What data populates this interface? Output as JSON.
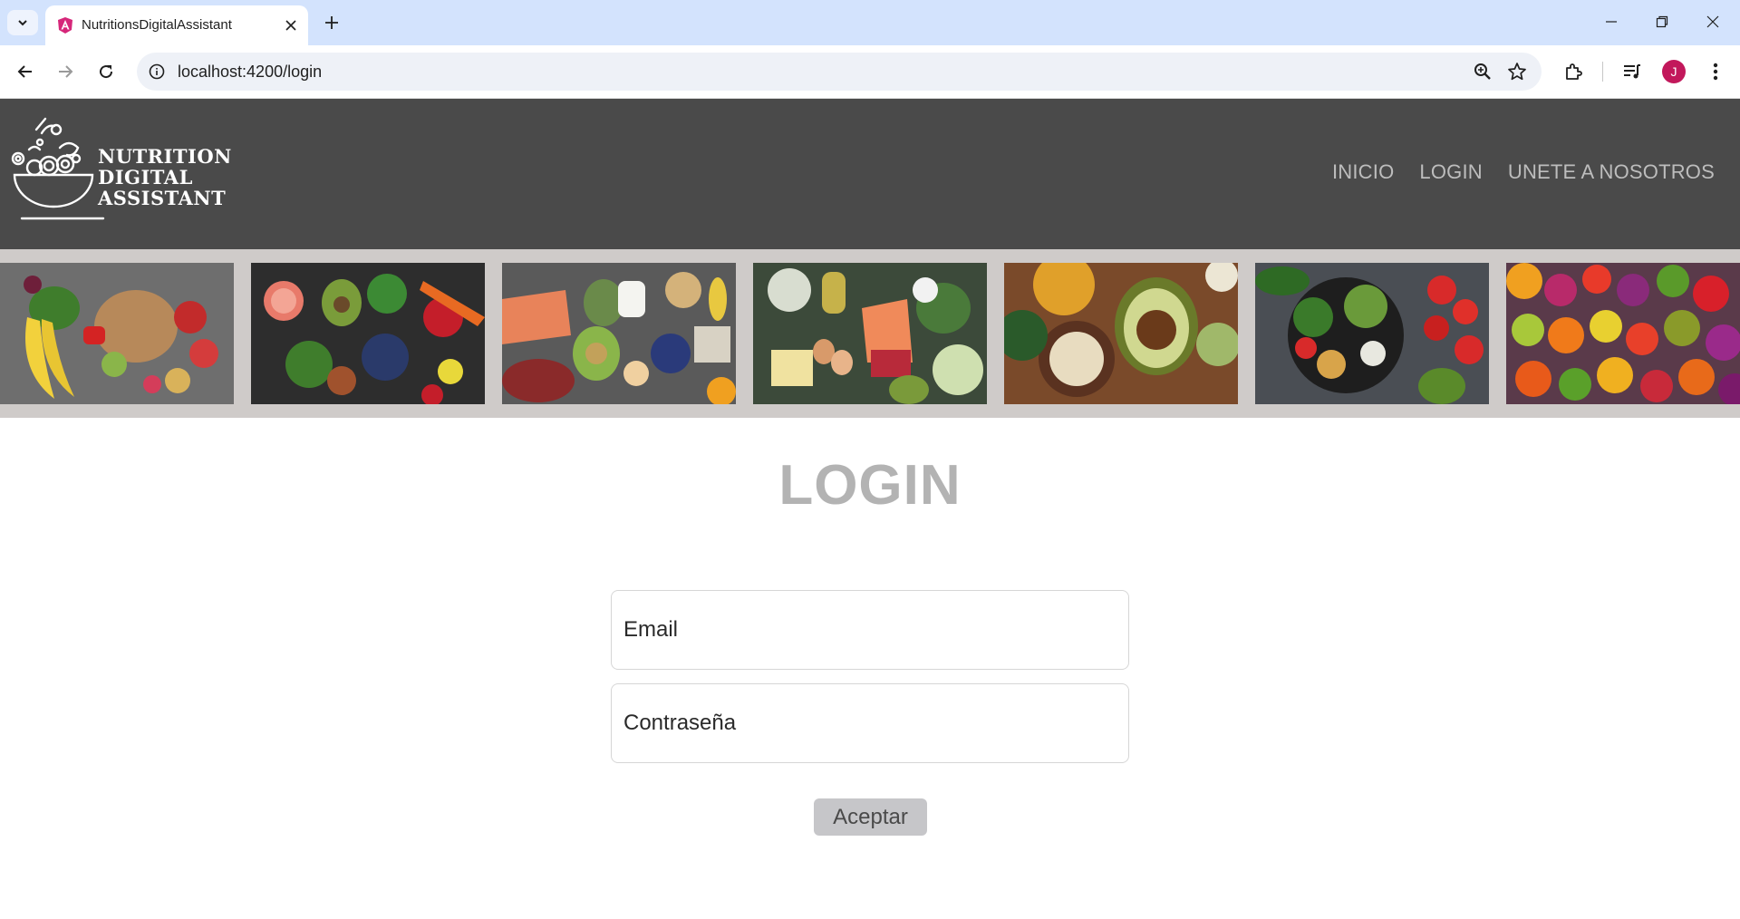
{
  "browser": {
    "tab_title": "NutritionsDigitalAssistant",
    "url": "localhost:4200/login",
    "profile_initial": "J",
    "profile_color": "#c2185b",
    "icons": [
      "tab-search-icon",
      "angular-favicon-icon",
      "close-icon",
      "plus-icon",
      "minimize-icon",
      "restore-icon",
      "close-window-icon",
      "back-icon",
      "forward-icon",
      "reload-icon",
      "info-icon",
      "zoom-icon",
      "star-icon",
      "extensions-icon",
      "media-icon",
      "menu-icon"
    ]
  },
  "header": {
    "logo_lines": [
      "NUTRITION",
      "DIGITAL",
      "ASSISTANT"
    ],
    "nav": [
      "INICIO",
      "LOGIN",
      "UNETE A NOSOTROS"
    ],
    "background_color": "#4a4a4a"
  },
  "gallery": {
    "images": [
      "fruit-vegetables-bread-photo",
      "vegetables-fruits-berries-photo",
      "fish-meat-vegetables-photo",
      "salmon-vegetables-eggs-photo",
      "avocado-spices-oats-photo",
      "salad-bowl-tomatoes-photo",
      "colorful-fruits-photo"
    ]
  },
  "login": {
    "title": "LOGIN",
    "email_placeholder": "Email",
    "password_placeholder": "Contraseña",
    "submit_label": "Aceptar"
  }
}
